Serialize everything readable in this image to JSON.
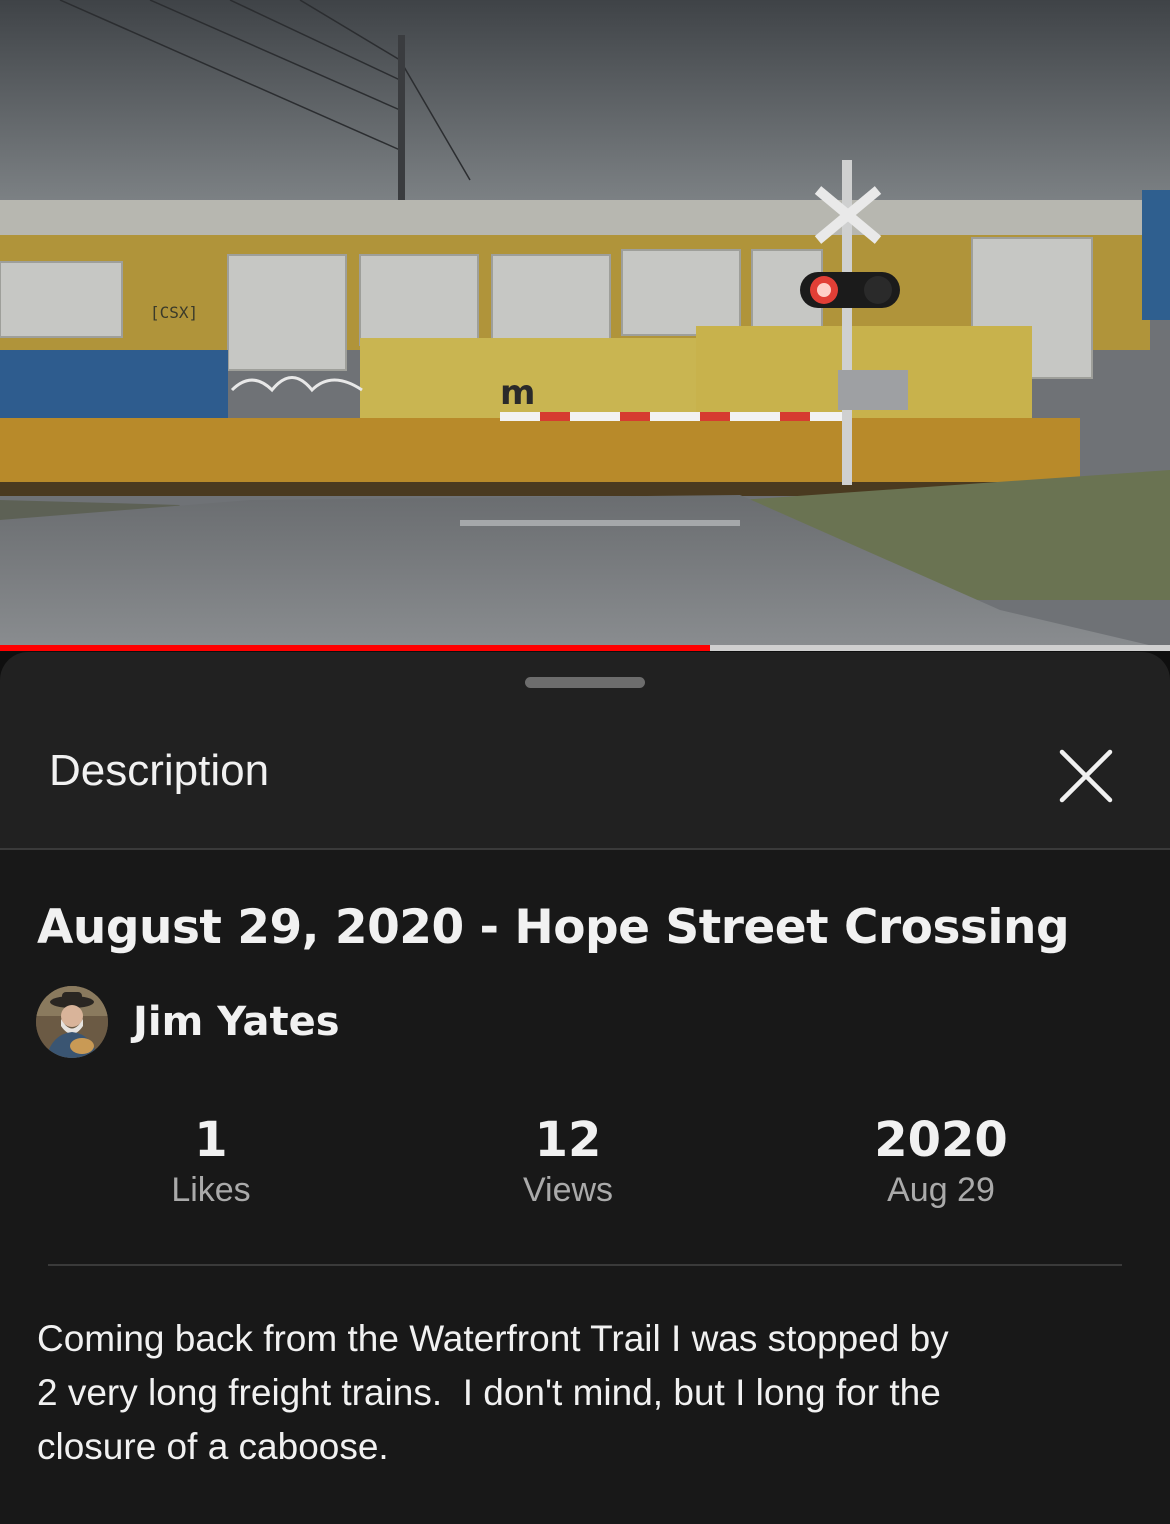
{
  "video": {
    "progress_fraction": 0.607,
    "thumbnail_alt": "Freight train passing a railroad crossing"
  },
  "sheet": {
    "title": "Description",
    "close_icon": "close-icon"
  },
  "details": {
    "title": "August 29, 2020 - Hope Street Crossing",
    "channel_name": "Jim Yates",
    "stats": [
      {
        "value": "1",
        "label": "Likes"
      },
      {
        "value": "12",
        "label": "Views"
      },
      {
        "value": "2020",
        "label": "Aug 29"
      }
    ],
    "description": "Coming back from the Waterfront Trail I was stopped by\n2 very long freight trains.  I don't mind, but I long for the\nclosure of a caboose."
  },
  "colors": {
    "progress": "#ff0000",
    "sheet_bg": "#212121",
    "content_bg": "#181818",
    "text": "#f1f1f1",
    "secondary_text": "#aaaaaa"
  }
}
